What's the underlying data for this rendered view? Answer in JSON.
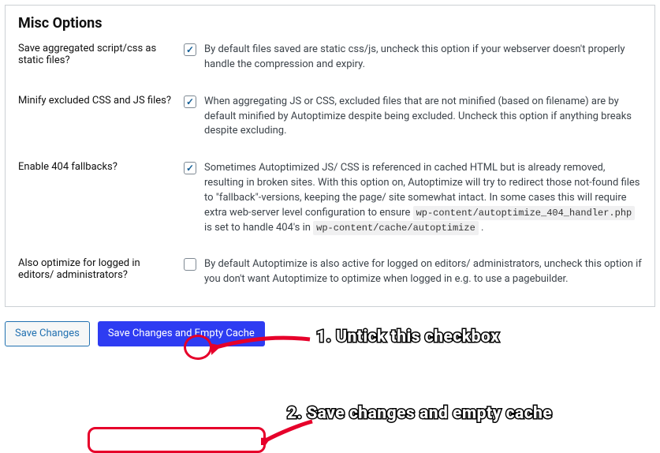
{
  "panel": {
    "title": "Misc Options"
  },
  "rows": {
    "save_static": {
      "label": "Save aggregated script/css as static files?",
      "checked": true,
      "desc": "By default files saved are static css/js, uncheck this option if your webserver doesn't properly handle the compression and expiry."
    },
    "minify_excluded": {
      "label": "Minify excluded CSS and JS files?",
      "checked": true,
      "desc": "When aggregating JS or CSS, excluded files that are not minified (based on filename) are by default minified by Autoptimize despite being excluded. Uncheck this option if anything breaks despite excluding."
    },
    "enable_404": {
      "label": "Enable 404 fallbacks?",
      "checked": true,
      "desc_pre": "Sometimes Autoptimized JS/ CSS is referenced in cached HTML but is already removed, resulting in broken sites. With this option on, Autoptimize will try to redirect those not-found files to \"fallback\"-versions, keeping the page/ site somewhat intact. In some cases this will require extra web-server level configuration to ensure ",
      "code1": "wp-content/autoptimize_404_handler.php",
      "desc_mid": " is set to handle 404's in ",
      "code2": "wp-content/cache/autoptimize",
      "desc_post": " ."
    },
    "also_optimize": {
      "label": "Also optimize for logged in editors/ administrators?",
      "checked": false,
      "desc": "By default Autoptimize is also active for logged on editors/ administrators, uncheck this option if you don't want Autoptimize to optimize when logged in e.g. to use a pagebuilder."
    }
  },
  "buttons": {
    "save": "Save Changes",
    "save_empty": "Save Changes and Empty Cache"
  },
  "annotations": {
    "step1": "1. Untick this checkbox",
    "step2": "2. Save changes and empty cache"
  }
}
